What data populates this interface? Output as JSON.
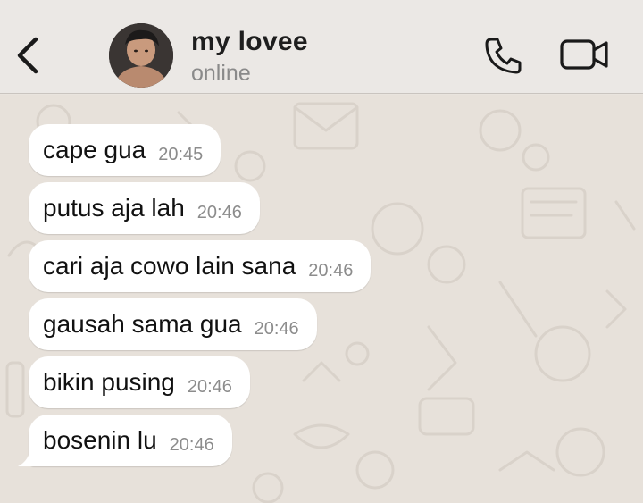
{
  "header": {
    "contact_name": "my lovee",
    "status": "online",
    "icons": {
      "back": "chevron-left-icon",
      "call": "phone-icon",
      "video": "video-camera-icon"
    }
  },
  "messages": [
    {
      "text": "cape gua",
      "time": "20:45"
    },
    {
      "text": "putus aja lah",
      "time": "20:46"
    },
    {
      "text": "cari aja cowo lain sana",
      "time": "20:46"
    },
    {
      "text": "gausah sama gua",
      "time": "20:46"
    },
    {
      "text": "bikin pusing",
      "time": "20:46"
    },
    {
      "text": "bosenin lu",
      "time": "20:46"
    }
  ],
  "colors": {
    "header_bg": "#ebe8e5",
    "chat_bg": "#e7e1da",
    "bubble_bg": "#ffffff",
    "time_text": "#8c8c8c"
  }
}
